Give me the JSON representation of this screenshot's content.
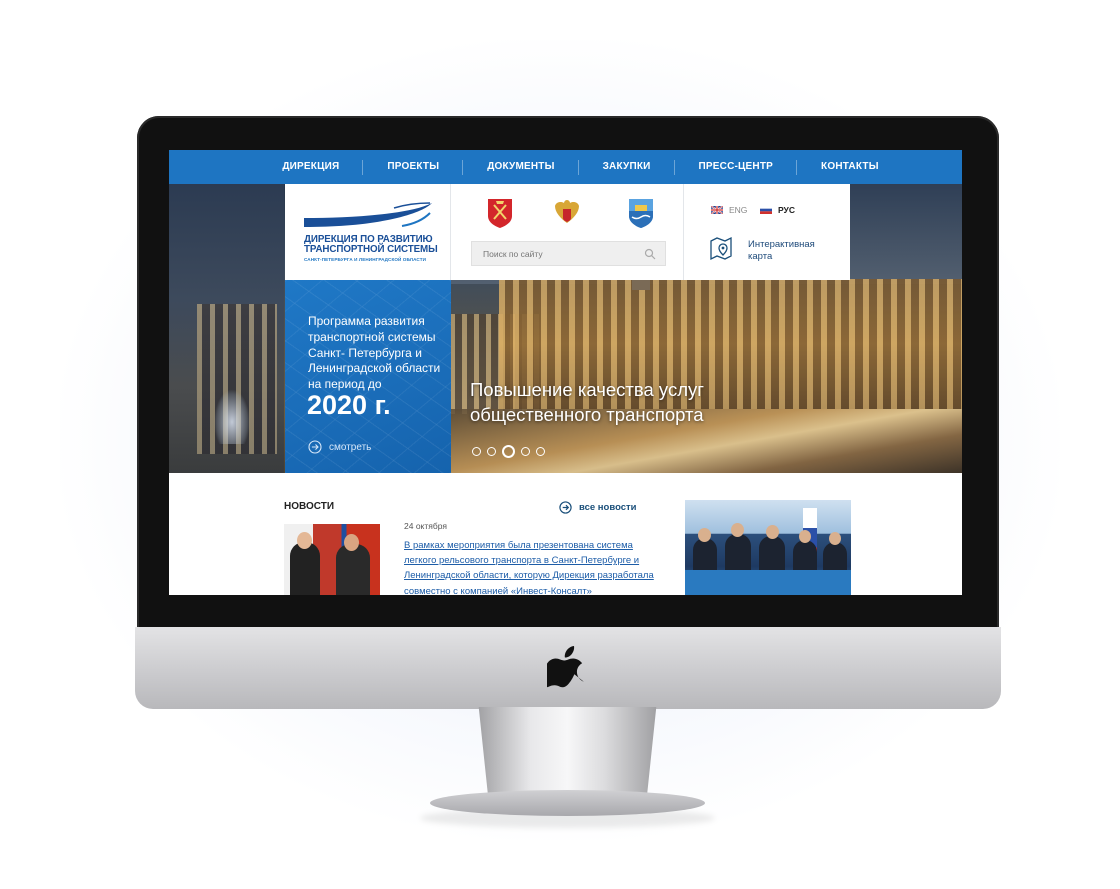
{
  "nav": {
    "items": [
      "ДИРЕКЦИЯ",
      "ПРОЕКТЫ",
      "ДОКУМЕНТЫ",
      "ЗАКУПКИ",
      "ПРЕСС-ЦЕНТР",
      "КОНТАКТЫ"
    ]
  },
  "logo": {
    "line1": "ДИРЕКЦИЯ ПО РАЗВИТИЮ",
    "line2": "ТРАНСПОРТНОЙ СИСТЕМЫ",
    "line3": "САНКТ-ПЕТЕРБУРГА И ЛЕНИНГРАДСКОЙ ОБЛАСТИ"
  },
  "search": {
    "placeholder": "Поиск по сайту"
  },
  "languages": {
    "eng": "ENG",
    "rus": "РУС"
  },
  "map": {
    "line1": "Интерактивная",
    "line2": "карта"
  },
  "program": {
    "text": "Программа развития транспортной системы Санкт- Петербурга и Ленинградской области на период до",
    "year": "2020 г.",
    "link": "смотреть"
  },
  "slider": {
    "title_line1": "Повышение качества услуг",
    "title_line2": "общественного транспорта",
    "dot_count": 5,
    "active_dot": 3
  },
  "news": {
    "title": "НОВОСТИ",
    "all_link": "все новости",
    "date": "24 октября",
    "text": "В рамках мероприятия была презентована система легкого рельсового транспорта в Санкт-Петербурге и Ленинградской области, которую Дирекция разработала совместно с компанией «Инвест-Консалт»"
  },
  "colors": {
    "primary": "#1e75c2",
    "logo": "#1a4f98",
    "link": "#1d5da8"
  }
}
